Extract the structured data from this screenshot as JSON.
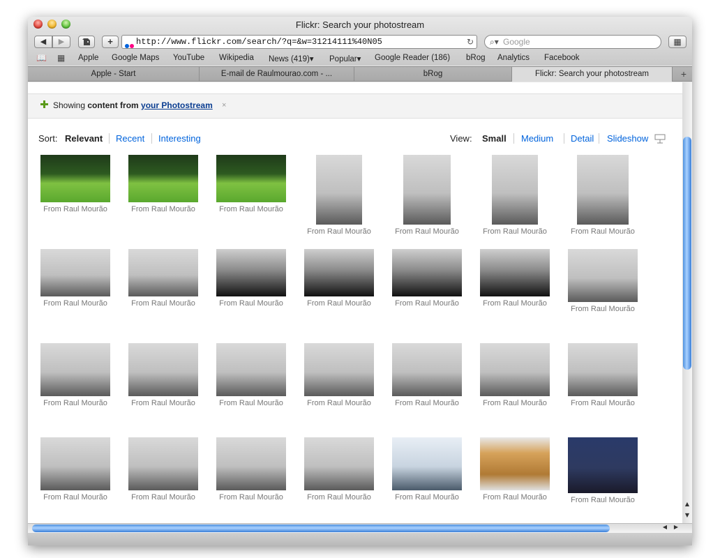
{
  "window": {
    "title": "Flickr: Search your photostream"
  },
  "toolbar": {
    "back_label": "◀",
    "forward_label": "▶",
    "add_label": "+",
    "address": "http://www.flickr.com/search/?q=&w=31214111%40N05",
    "search_placeholder": "Google"
  },
  "bookmarks": [
    "Apple",
    "Google Maps",
    "YouTube",
    "Wikipedia",
    "News (419)▾",
    "Popular▾",
    "Google Reader (186)",
    "bRog",
    "Analytics",
    "Facebook"
  ],
  "tabs": [
    {
      "label": "Apple - Start",
      "active": false
    },
    {
      "label": "E-mail de Raulmourao.com - ...",
      "active": false
    },
    {
      "label": "bRog",
      "active": false
    },
    {
      "label": "Flickr: Search your photostream",
      "active": true
    }
  ],
  "showing": {
    "prefix": "Showing ",
    "bold": "content from ",
    "link": "your Photostream",
    "close": "×"
  },
  "sort": {
    "label": "Sort:",
    "options": [
      "Relevant",
      "Recent",
      "Interesting"
    ],
    "active": "Relevant"
  },
  "view": {
    "label": "View:",
    "options": [
      "Small",
      "Medium",
      "Detail",
      "Slideshow"
    ],
    "active": "Small"
  },
  "results": {
    "from": "From",
    "owner": "Raul Mourão"
  },
  "colors": {
    "link": "#0063dc",
    "accent_scroll": "#4f92e0"
  }
}
